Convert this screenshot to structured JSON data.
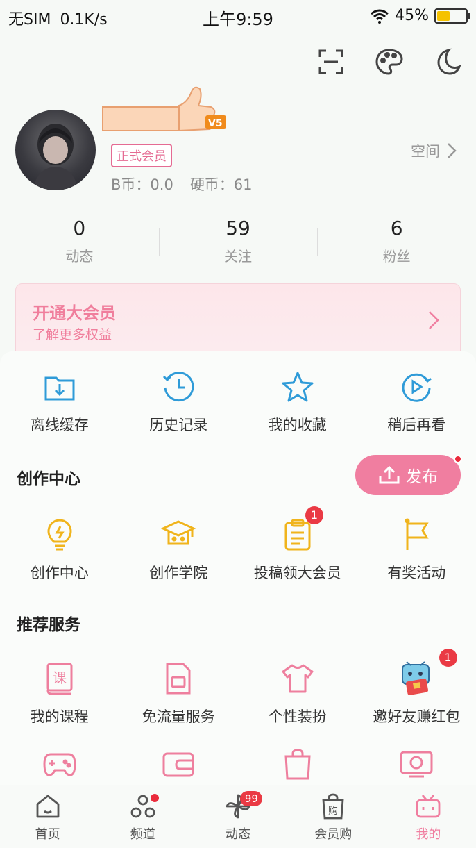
{
  "status_bar": {
    "carrier": "无SIM",
    "speed": "0.1K/s",
    "time": "上午9:59",
    "battery": "45%",
    "battery_level": 0.45
  },
  "profile": {
    "vip_badge": "正式会员",
    "b_coin": "B币：0.0",
    "hard_coin": "硬币：61",
    "space_label": "空间"
  },
  "stats": [
    {
      "value": "0",
      "label": "动态"
    },
    {
      "value": "59",
      "label": "关注"
    },
    {
      "value": "6",
      "label": "粉丝"
    }
  ],
  "vip_banner": {
    "title": "开通大会员",
    "subtitle": "了解更多权益"
  },
  "quick_actions": [
    {
      "label": "离线缓存",
      "icon": "download-folder-icon"
    },
    {
      "label": "历史记录",
      "icon": "history-clock-icon"
    },
    {
      "label": "我的收藏",
      "icon": "star-icon"
    },
    {
      "label": "稍后再看",
      "icon": "watch-later-icon"
    }
  ],
  "creation": {
    "title": "创作中心",
    "publish_label": "发布",
    "items": [
      {
        "label": "创作中心",
        "icon": "lightbulb-icon"
      },
      {
        "label": "创作学院",
        "icon": "graduation-cap-icon"
      },
      {
        "label": "投稿领大会员",
        "icon": "clipboard-icon",
        "badge": "1"
      },
      {
        "label": "有奖活动",
        "icon": "flag-icon"
      }
    ]
  },
  "services": {
    "title": "推荐服务",
    "items": [
      {
        "label": "我的课程",
        "icon": "course-book-icon",
        "glyph": "课"
      },
      {
        "label": "免流量服务",
        "icon": "sim-card-icon"
      },
      {
        "label": "个性装扮",
        "icon": "tshirt-icon"
      },
      {
        "label": "邀好友赚红包",
        "icon": "tv-mascot-red-envelope-icon",
        "badge": "1"
      }
    ]
  },
  "tabbar": [
    {
      "label": "首页",
      "icon": "home-icon"
    },
    {
      "label": "频道",
      "icon": "channel-icon"
    },
    {
      "label": "动态",
      "icon": "pinwheel-icon",
      "badge": "99"
    },
    {
      "label": "会员购",
      "icon": "shopping-bag-icon",
      "glyph": "购"
    },
    {
      "label": "我的",
      "icon": "tv-icon"
    }
  ],
  "colors": {
    "accent_pink": "#f07ea0",
    "blue_icon": "#2f9bd8",
    "yellow_icon": "#f0b41c",
    "badge_red": "#ea3a44"
  }
}
